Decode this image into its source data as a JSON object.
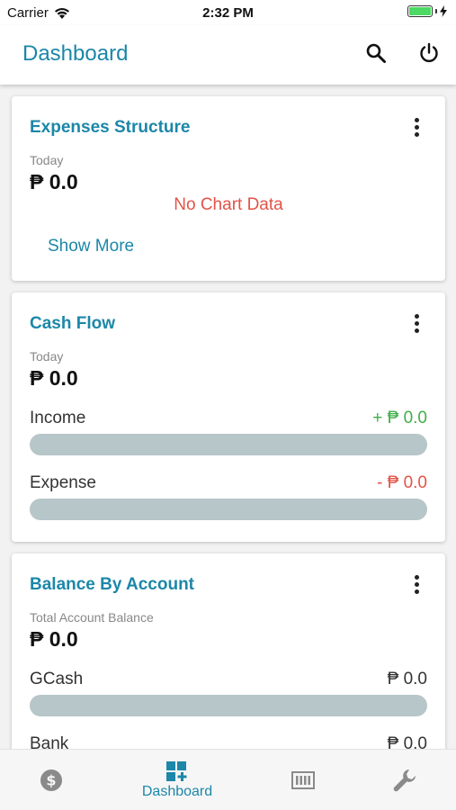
{
  "status_bar": {
    "carrier": "Carrier",
    "time": "2:32 PM"
  },
  "header": {
    "title": "Dashboard"
  },
  "expenses_card": {
    "title": "Expenses Structure",
    "period": "Today",
    "amount": "₱ 0.0",
    "no_data": "No Chart Data",
    "show_more": "Show More"
  },
  "cashflow_card": {
    "title": "Cash Flow",
    "period": "Today",
    "amount": "₱ 0.0",
    "income_label": "Income",
    "income_value": "+ ₱ 0.0",
    "expense_label": "Expense",
    "expense_value": "- ₱ 0.0"
  },
  "balance_card": {
    "title": "Balance By Account",
    "subtitle": "Total Account Balance",
    "amount": "₱ 0.0",
    "accounts": [
      {
        "name": "GCash",
        "value": "₱ 0.0"
      },
      {
        "name": "Bank",
        "value": "₱ 0.0"
      }
    ]
  },
  "bottom_nav": {
    "active_label": "Dashboard",
    "items": [
      "dollar-icon",
      "dashboard-add-icon",
      "ledger-icon",
      "wrench-icon"
    ]
  },
  "colors": {
    "accent": "#1c87a8",
    "income": "#3fae49",
    "expense": "#e35347",
    "bar": "#b7c6c8"
  }
}
